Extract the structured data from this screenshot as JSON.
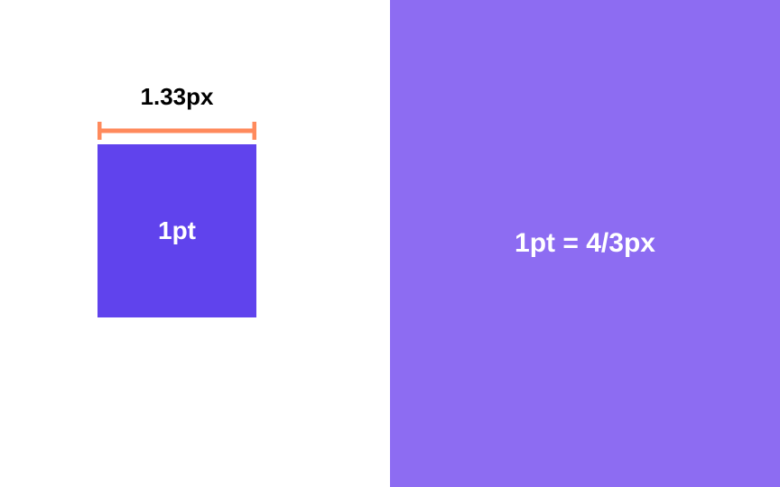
{
  "diagram": {
    "dimension_label": "1.33px",
    "square_label": "1pt",
    "equation": "1pt = 4/3px"
  },
  "colors": {
    "square_fill": "#6043ed",
    "right_panel_fill": "#8d6cf2",
    "dimension_line": "#ff8a5c",
    "text_dark": "#000000",
    "text_light": "#ffffff"
  }
}
